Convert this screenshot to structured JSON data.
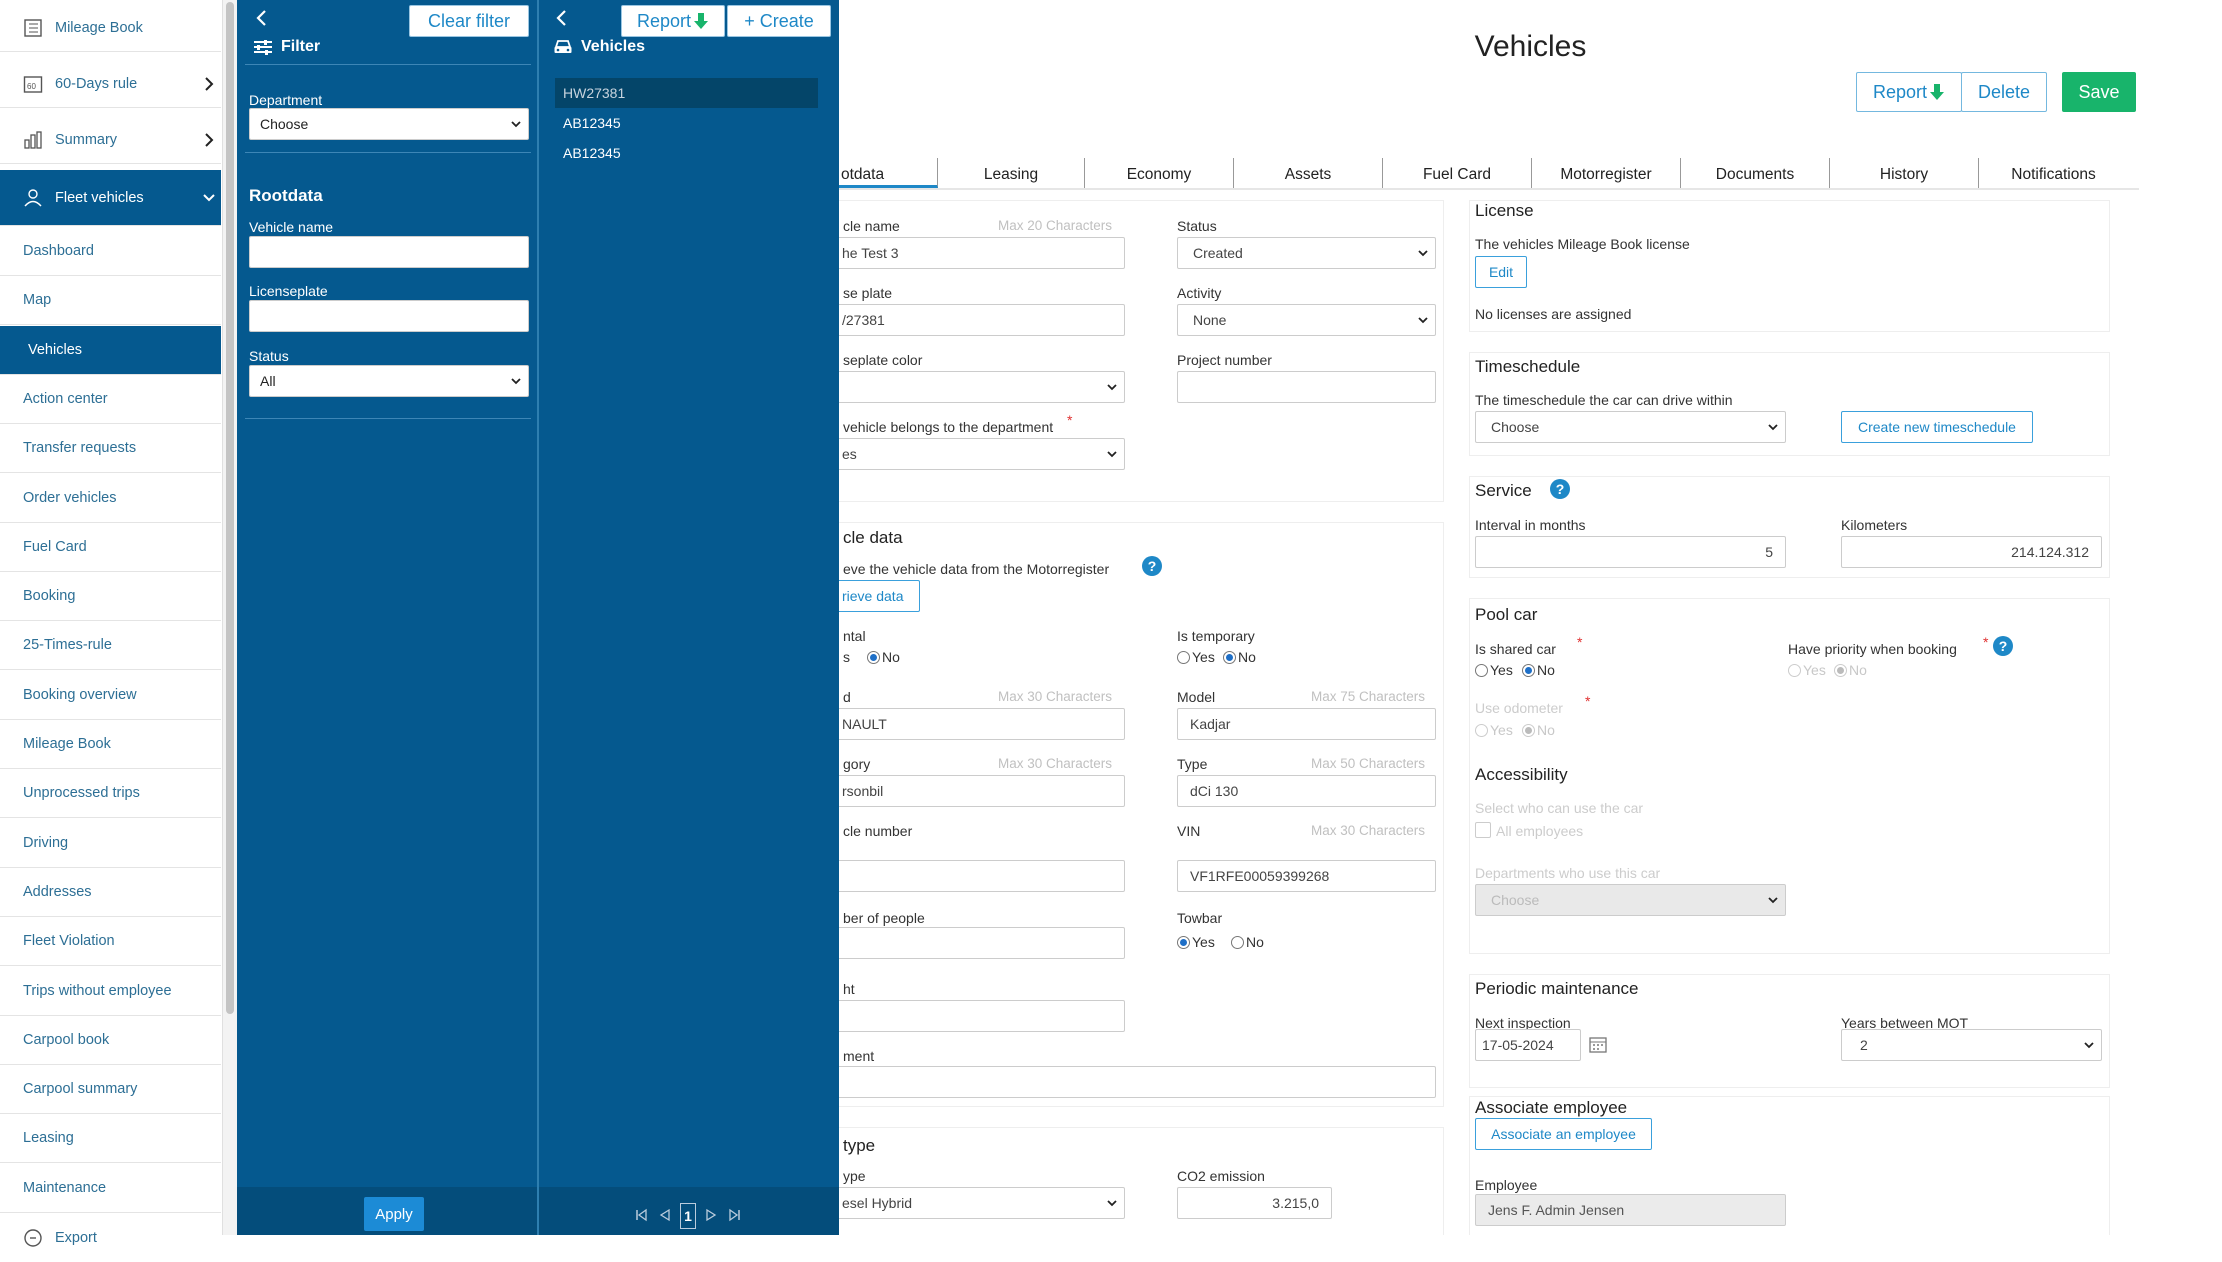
{
  "sidebar": {
    "items": [
      {
        "label": "Mileage Book",
        "icon": "book-icon"
      },
      {
        "label": "60-Days rule",
        "icon": "calendar-60-icon",
        "chevron": "right"
      },
      {
        "label": "Summary",
        "icon": "bar-chart-icon",
        "chevron": "right"
      },
      {
        "label": "Fleet vehicles",
        "icon": "fleet-users-icon",
        "chevron": "down",
        "active": true
      }
    ],
    "subitems": [
      "Dashboard",
      "Map",
      "Vehicles",
      "Action center",
      "Transfer requests",
      "Order vehicles",
      "Fuel Card",
      "Booking",
      "25-Times-rule",
      "Booking overview",
      "Mileage Book",
      "Unprocessed trips",
      "Driving",
      "Addresses",
      "Fleet Violation",
      "Trips without employee",
      "Carpool book",
      "Carpool summary",
      "Leasing",
      "Maintenance"
    ],
    "export_label": "Export",
    "export_icon": "export-icon",
    "active_subitem": "Vehicles"
  },
  "filter": {
    "clear_label": "Clear filter",
    "title": "Filter",
    "department_label": "Department",
    "department_value": "Choose",
    "rootdata_title": "Rootdata",
    "vehicle_name_label": "Vehicle name",
    "licenseplate_label": "Licenseplate",
    "status_label": "Status",
    "status_value": "All",
    "apply_label": "Apply"
  },
  "vehicle_list": {
    "report_label": "Report",
    "create_label": "+ Create",
    "title": "Vehicles",
    "items": [
      "HW27381",
      "AB12345",
      "AB12345"
    ],
    "current_page": "1"
  },
  "main": {
    "title": "Vehicles",
    "report_label": "Report",
    "delete_label": "Delete",
    "save_label": "Save",
    "tabs": [
      "otdata",
      "Leasing",
      "Economy",
      "Assets",
      "Fuel Card",
      "Motorregister",
      "Documents",
      "History",
      "Notifications"
    ],
    "colors": {
      "accent": "#1e88c7",
      "save": "#18b46b",
      "panel": "#05598f"
    }
  },
  "rootdata": {
    "vehicle_name_label": "cle name",
    "vehicle_name_hint": "Max 20 Characters",
    "vehicle_name_value": "he Test 3",
    "status_label": "Status",
    "status_value": "Created",
    "license_plate_label": "se plate",
    "license_plate_value": "/27381",
    "activity_label": "Activity",
    "activity_value": "None",
    "plate_color_label": "seplate color",
    "project_number_label": "Project number",
    "department_label": "vehicle belongs to the department",
    "department_value": "es"
  },
  "vehicle_data": {
    "title": "cle data",
    "retrieve_text": "eve the vehicle data from the Motorregister",
    "retrieve_button": "rieve data",
    "rental_label": "ntal",
    "rental_yes": "s",
    "rental_no": "No",
    "temporary_label": "Is temporary",
    "yes": "Yes",
    "no": "No",
    "brand_label": "d",
    "brand_hint": "Max 30 Characters",
    "brand_value": "NAULT",
    "model_label": "Model",
    "model_hint": "Max 75 Characters",
    "model_value": "Kadjar",
    "category_label": "gory",
    "category_hint": "Max 30 Characters",
    "category_value": "rsonbil",
    "type_label": "Type",
    "type_hint": "Max 50 Characters",
    "type_value": "dCi 130",
    "vehicle_number_label": "cle number",
    "vin_label": "VIN",
    "vin_hint": "Max 30 Characters",
    "vin_value": "VF1RFE00059399268",
    "people_label": "ber of people",
    "towbar_label": "Towbar",
    "weight_label": "ht",
    "comment_label": "ment"
  },
  "fuel": {
    "title": "type",
    "fuel_label": "ype",
    "fuel_value": "esel Hybrid",
    "co2_label": "CO2 emission",
    "co2_value": "3.215,0"
  },
  "license": {
    "title": "License",
    "text": "The vehicles Mileage Book license",
    "edit_label": "Edit",
    "none_text": "No licenses are assigned"
  },
  "timeschedule": {
    "title": "Timeschedule",
    "text": "The timeschedule the car can drive within",
    "select_value": "Choose",
    "create_label": "Create new timeschedule"
  },
  "service": {
    "title": "Service",
    "interval_label": "Interval in months",
    "interval_value": "5",
    "km_label": "Kilometers",
    "km_value": "214.124.312"
  },
  "poolcar": {
    "title": "Pool car",
    "shared_label": "Is shared car",
    "priority_label": "Have priority when booking",
    "odometer_label": "Use odometer",
    "yes": "Yes",
    "no": "No"
  },
  "accessibility": {
    "title": "Accessibility",
    "who_label": "Select who can use the car",
    "all_label": "All employees",
    "departments_label": "Departments who use this car",
    "departments_value": "Choose"
  },
  "maintenance": {
    "title": "Periodic maintenance",
    "inspection_label": "Next inspection",
    "inspection_value": "17-05-2024",
    "mot_label": "Years between MOT",
    "mot_value": "2"
  },
  "associate": {
    "title": "Associate employee",
    "button_label": "Associate an employee",
    "employee_label": "Employee",
    "employee_value": "Jens F. Admin Jensen"
  }
}
